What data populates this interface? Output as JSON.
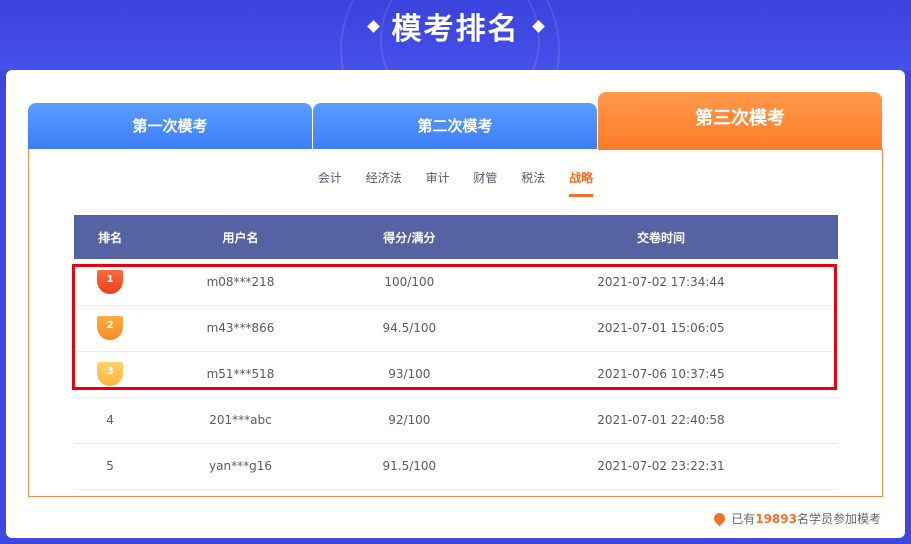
{
  "banner": {
    "title": "模考排名"
  },
  "tabs": [
    {
      "label": "第一次模考"
    },
    {
      "label": "第二次模考"
    },
    {
      "label": "第三次模考"
    }
  ],
  "subjects": [
    "会计",
    "经济法",
    "审计",
    "财管",
    "税法",
    "战略"
  ],
  "active_subject": "战略",
  "table": {
    "headers": [
      "排名",
      "用户名",
      "得分/满分",
      "交卷时间"
    ],
    "rows": [
      {
        "rank": "1",
        "user": "m08***218",
        "score": "100/100",
        "time": "2021-07-02 17:34:44"
      },
      {
        "rank": "2",
        "user": "m43***866",
        "score": "94.5/100",
        "time": "2021-07-01 15:06:05"
      },
      {
        "rank": "3",
        "user": "m51***518",
        "score": "93/100",
        "time": "2021-07-06 10:37:45"
      },
      {
        "rank": "4",
        "user": "201***abc",
        "score": "92/100",
        "time": "2021-07-01 22:40:58"
      },
      {
        "rank": "5",
        "user": "yan***g16",
        "score": "91.5/100",
        "time": "2021-07-02 23:22:31"
      }
    ]
  },
  "footer": {
    "prefix": "已有",
    "count": "19893",
    "suffix": "名学员参加模考"
  },
  "colors": {
    "banner_bg": "#3f47e0",
    "tab_blue": "#4a8cff",
    "tab_active": "#ff8a36",
    "header_bg": "#5563a3",
    "accent": "#f2712b",
    "highlight_border": "#e60012",
    "medal_gold_red": "#f0502a",
    "medal_orange": "#ff9a2e",
    "medal_yellow": "#ffc04a"
  }
}
